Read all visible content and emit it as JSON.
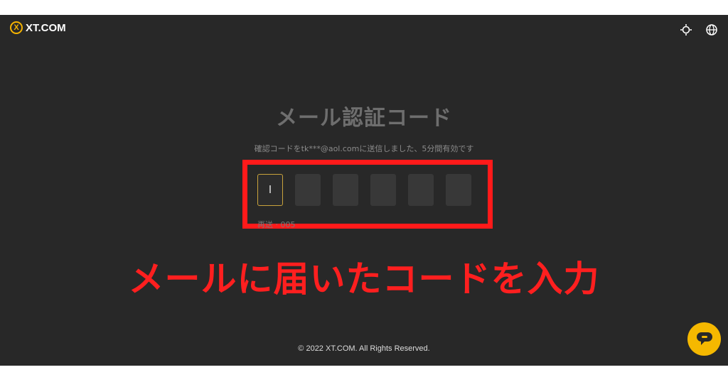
{
  "header": {
    "logo_mark": "X",
    "logo_text": "XT.COM",
    "icons": [
      "brightness-icon",
      "globe-icon"
    ]
  },
  "main": {
    "title": "メール認証コード",
    "subtitle": "確認コードをtk***@aol.comに送信しました、5分間有効です",
    "code_inputs": [
      "I",
      "",
      "",
      "",
      "",
      ""
    ],
    "resend_text": "再送 · 005"
  },
  "annotation": {
    "text": "メールに届いたコードを入力",
    "color": "#ff1f1f"
  },
  "footer": {
    "copyright": "© 2022 XT.COM. All Rights Reserved."
  },
  "colors": {
    "background": "#282828",
    "accent": "#f5b800",
    "highlight": "#ff1a1a"
  }
}
